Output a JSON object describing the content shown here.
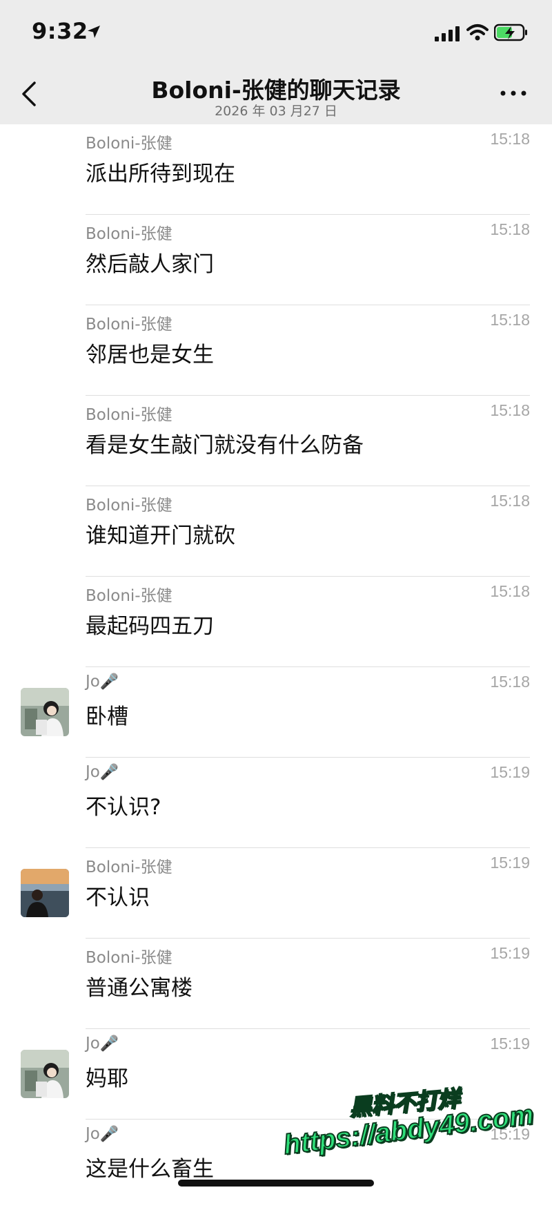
{
  "status_bar": {
    "time": "9:32",
    "icons": [
      "location-arrow-icon",
      "cellular-signal-icon",
      "wifi-icon",
      "battery-charging-icon"
    ],
    "battery_color": "#4cd964"
  },
  "nav": {
    "title": "Boloni-张健的聊天记录",
    "subtitle": "2026 年 03 月27 日",
    "back_icon": "chevron-left-icon",
    "more_icon": "more-dots-icon"
  },
  "messages": [
    {
      "sender": "Boloni-张健",
      "time": "15:18",
      "text": "派出所待到现在"
    },
    {
      "sender": "Boloni-张健",
      "time": "15:18",
      "text": "然后敲人家门"
    },
    {
      "sender": "Boloni-张健",
      "time": "15:18",
      "text": "邻居也是女生"
    },
    {
      "sender": "Boloni-张健",
      "time": "15:18",
      "text": "看是女生敲门就没有什么防备"
    },
    {
      "sender": "Boloni-张健",
      "time": "15:18",
      "text": "谁知道开门就砍"
    },
    {
      "sender": "Boloni-张健",
      "time": "15:18",
      "text": "最起码四五刀"
    },
    {
      "sender": "Jo",
      "time": "15:18",
      "text": "卧槽"
    },
    {
      "sender": "Jo",
      "time": "15:19",
      "text": "不认识?"
    },
    {
      "sender": "Boloni-张健",
      "time": "15:19",
      "text": "不认识"
    },
    {
      "sender": "Boloni-张健",
      "time": "15:19",
      "text": "普通公寓楼"
    },
    {
      "sender": "Jo",
      "time": "15:19",
      "text": "妈耶"
    },
    {
      "sender": "Jo",
      "time": "15:19",
      "text": "这是什么畜生"
    }
  ],
  "watermark": {
    "line1": "黑料不打烊",
    "line2": "https://abdy49.com"
  }
}
